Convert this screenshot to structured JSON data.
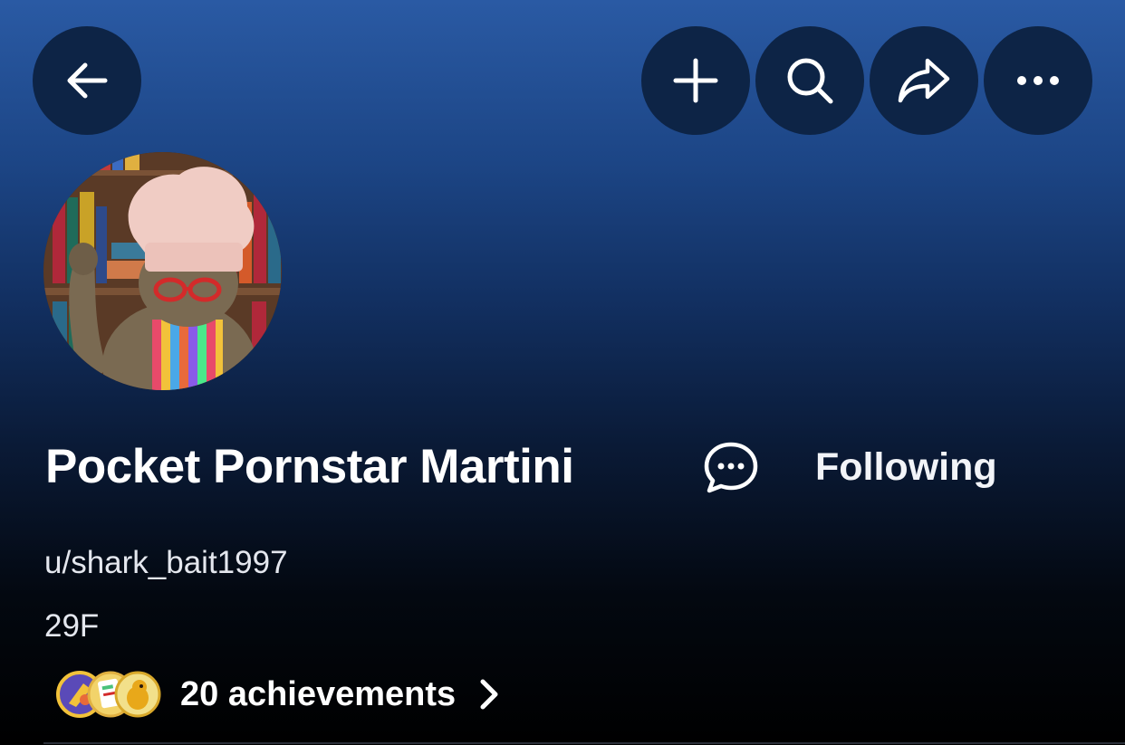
{
  "header": {
    "back_icon": "arrow-left-icon",
    "actions": [
      {
        "id": "add",
        "icon": "plus-icon"
      },
      {
        "id": "search",
        "icon": "search-icon"
      },
      {
        "id": "share",
        "icon": "share-arrow-icon"
      },
      {
        "id": "more",
        "icon": "more-horizontal-icon"
      }
    ]
  },
  "profile": {
    "avatar_alt": "profile-avatar",
    "display_name": "Pocket Pornstar Martini",
    "chat_icon": "chat-bubble-icon",
    "follow_label": "Following",
    "username": "u/shark_bait1997",
    "bio": "29F"
  },
  "achievements": {
    "label": "20 achievements",
    "badge_count": 3,
    "chevron_icon": "chevron-right-icon"
  },
  "colors": {
    "button_bg": "#0d2446",
    "text": "#ffffff",
    "gradient_top": "#2a5aa4",
    "gradient_bottom": "#000000"
  }
}
